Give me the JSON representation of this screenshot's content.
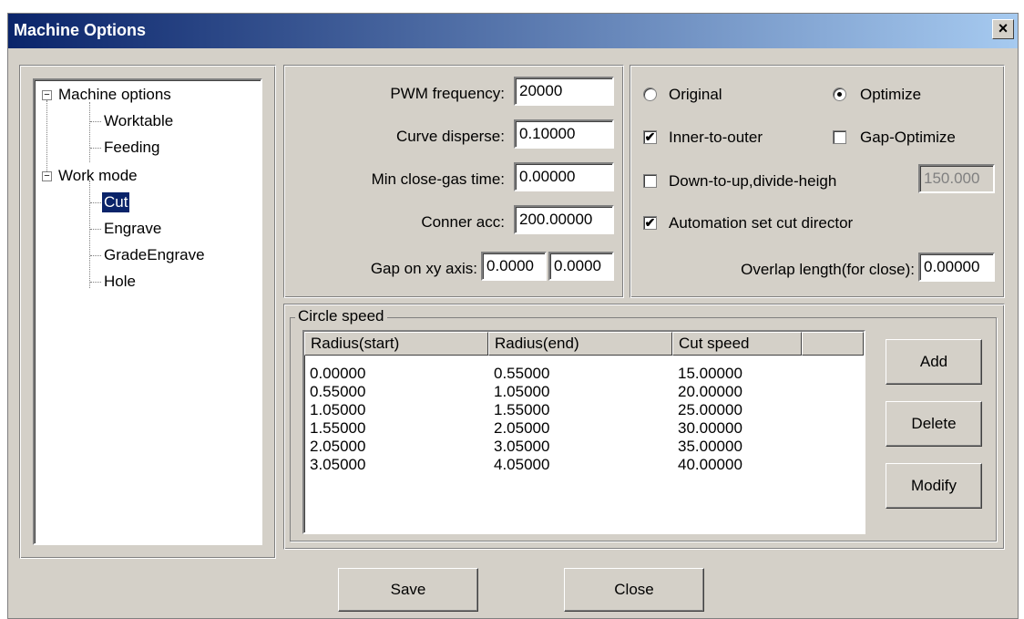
{
  "window": {
    "title": "Machine Options",
    "close_label": "×"
  },
  "tree": {
    "machine_options": {
      "label": "Machine options",
      "children": [
        "Worktable",
        "Feeding"
      ]
    },
    "work_mode": {
      "label": "Work mode",
      "children": [
        "Cut",
        "Engrave",
        "GradeEngrave",
        "Hole"
      ],
      "selected": "Cut"
    },
    "toggle_symbol": "−"
  },
  "params": {
    "pwm_frequency": {
      "label": "PWM frequency:",
      "value": "20000"
    },
    "curve_disperse": {
      "label": "Curve disperse:",
      "value": "0.10000"
    },
    "min_close_gas_time": {
      "label": "Min close-gas time:",
      "value": "0.00000"
    },
    "conner_acc": {
      "label": "Conner acc:",
      "value": "200.00000"
    },
    "gap_on_xy": {
      "label": "Gap on xy axis:",
      "value_x": "0.0000",
      "value_y": "0.0000"
    }
  },
  "options": {
    "original": {
      "label": "Original",
      "selected": false
    },
    "optimize": {
      "label": "Optimize",
      "selected": true
    },
    "inner_to_outer": {
      "label": "Inner-to-outer",
      "checked": true
    },
    "gap_optimize": {
      "label": "Gap-Optimize",
      "checked": false
    },
    "down_to_up": {
      "label": "Down-to-up,divide-heigh",
      "checked": false,
      "value": "150.000"
    },
    "auto_cut_director": {
      "label": "Automation set cut director",
      "checked": true
    },
    "overlap_length": {
      "label": "Overlap length(for close):",
      "value": "0.00000"
    },
    "check_mark": "✔"
  },
  "circle_speed": {
    "title": "Circle speed",
    "columns": [
      "Radius(start)",
      "Radius(end)",
      "Cut speed"
    ],
    "rows": [
      [
        "0.00000",
        "0.55000",
        "15.00000"
      ],
      [
        "0.55000",
        "1.05000",
        "20.00000"
      ],
      [
        "1.05000",
        "1.55000",
        "25.00000"
      ],
      [
        "1.55000",
        "2.05000",
        "30.00000"
      ],
      [
        "2.05000",
        "3.05000",
        "35.00000"
      ],
      [
        "3.05000",
        "4.05000",
        "40.00000"
      ]
    ],
    "add_label": "Add",
    "delete_label": "Delete",
    "modify_label": "Modify"
  },
  "footer": {
    "save_label": "Save",
    "close_label": "Close"
  }
}
